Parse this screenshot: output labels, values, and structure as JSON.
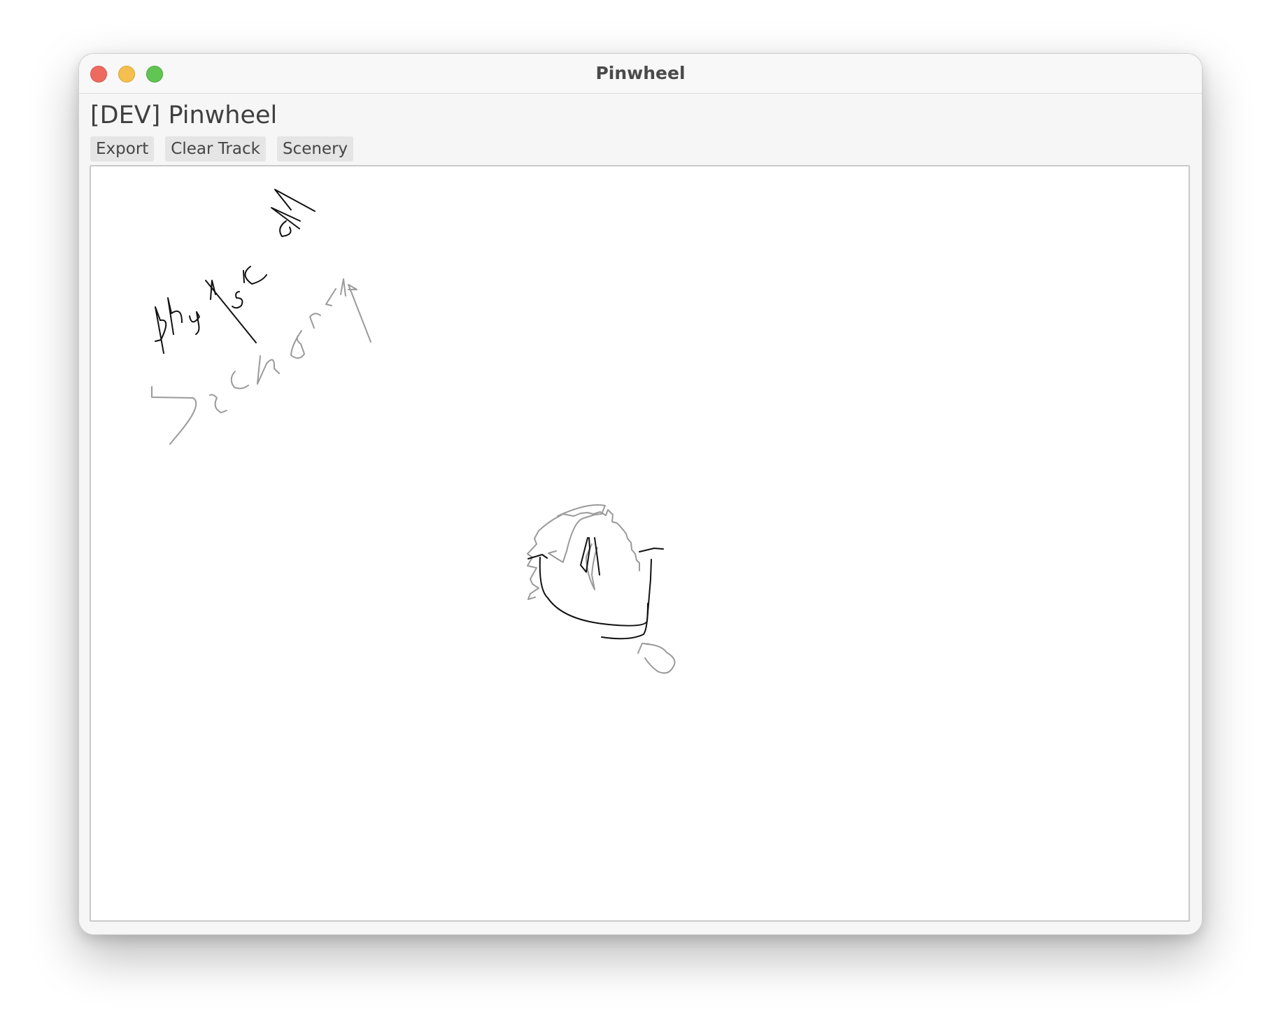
{
  "window": {
    "title": "Pinwheel",
    "controls": {
      "close": "close-button",
      "minimize": "minimize-button",
      "maximize": "maximize-button"
    }
  },
  "app": {
    "heading": "[DEV] Pinwheel"
  },
  "toolbar": {
    "export_label": "Export",
    "clear_track_label": "Clear Track",
    "scenery_label": "Scenery"
  },
  "canvas": {
    "stroke_colors": {
      "track": "#111111",
      "scenery": "#9a9a9a"
    }
  }
}
